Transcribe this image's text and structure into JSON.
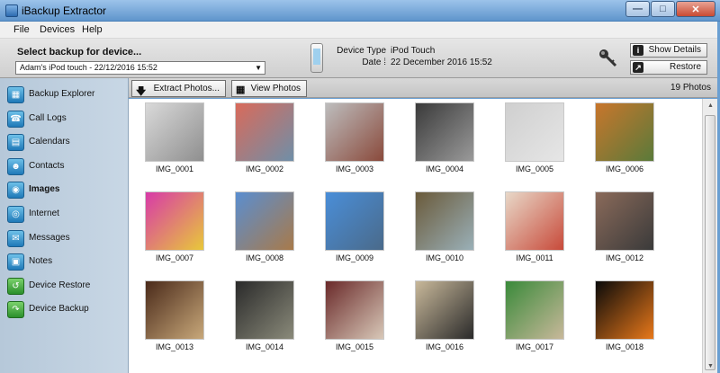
{
  "window": {
    "title": "iBackup Extractor"
  },
  "menu": [
    "File",
    "Devices",
    "Help"
  ],
  "device": {
    "select_label": "Select backup for device...",
    "selected": "Adam's iPod touch  -  22/12/2016 15:52",
    "type_key": "Device Type :",
    "type_value": "iPod Touch",
    "date_key": "Date :",
    "date_value": "22 December 2016 15:52",
    "show_details": "Show Details",
    "restore": "Restore"
  },
  "sidebar": {
    "items": [
      {
        "label": "Backup Explorer",
        "icon": "backup-explorer-icon"
      },
      {
        "label": "Call Logs",
        "icon": "phone-icon"
      },
      {
        "label": "Calendars",
        "icon": "calendar-icon"
      },
      {
        "label": "Contacts",
        "icon": "contacts-icon"
      },
      {
        "label": "Images",
        "icon": "images-icon"
      },
      {
        "label": "Internet",
        "icon": "internet-icon"
      },
      {
        "label": "Messages",
        "icon": "messages-icon"
      },
      {
        "label": "Notes",
        "icon": "notes-icon"
      },
      {
        "label": "Device Restore",
        "icon": "device-restore-icon"
      },
      {
        "label": "Device Backup",
        "icon": "device-backup-icon"
      }
    ],
    "active": "Images"
  },
  "toolbar": {
    "extract_label": "Extract Photos...",
    "view_label": "View Photos",
    "count": "19 Photos"
  },
  "photos": [
    {
      "name": "IMG_0001",
      "colors": [
        "#d9d9d9",
        "#8f8f8f"
      ]
    },
    {
      "name": "IMG_0002",
      "colors": [
        "#d96a5a",
        "#6f8fa8"
      ]
    },
    {
      "name": "IMG_0003",
      "colors": [
        "#bdbdbd",
        "#8a4a3c"
      ]
    },
    {
      "name": "IMG_0004",
      "colors": [
        "#3a3a3a",
        "#9a9a9a"
      ]
    },
    {
      "name": "IMG_0005",
      "colors": [
        "#cfcfcf",
        "#e6e6e6"
      ]
    },
    {
      "name": "IMG_0006",
      "colors": [
        "#c8762c",
        "#5a7a3a"
      ]
    },
    {
      "name": "IMG_0007",
      "colors": [
        "#d83aa8",
        "#e8c83a"
      ]
    },
    {
      "name": "IMG_0008",
      "colors": [
        "#5a8ed0",
        "#a87a4a"
      ]
    },
    {
      "name": "IMG_0009",
      "colors": [
        "#4a8ed8",
        "#4a6a8a"
      ]
    },
    {
      "name": "IMG_0010",
      "colors": [
        "#6a5a3a",
        "#9ab0b8"
      ]
    },
    {
      "name": "IMG_0011",
      "colors": [
        "#e8d8c8",
        "#c84a3a"
      ]
    },
    {
      "name": "IMG_0012",
      "colors": [
        "#8a6a5a",
        "#3a3a3a"
      ]
    },
    {
      "name": "IMG_0013",
      "colors": [
        "#4a2a1a",
        "#c8a87a"
      ]
    },
    {
      "name": "IMG_0014",
      "colors": [
        "#2a2a2a",
        "#8a8a7a"
      ]
    },
    {
      "name": "IMG_0015",
      "colors": [
        "#6a2a2a",
        "#d8c8b8"
      ]
    },
    {
      "name": "IMG_0016",
      "colors": [
        "#c8b89a",
        "#2a2a2a"
      ]
    },
    {
      "name": "IMG_0017",
      "colors": [
        "#3a8a3a",
        "#c8b89a"
      ]
    },
    {
      "name": "IMG_0018",
      "colors": [
        "#0a0a0a",
        "#e8781a"
      ]
    }
  ]
}
